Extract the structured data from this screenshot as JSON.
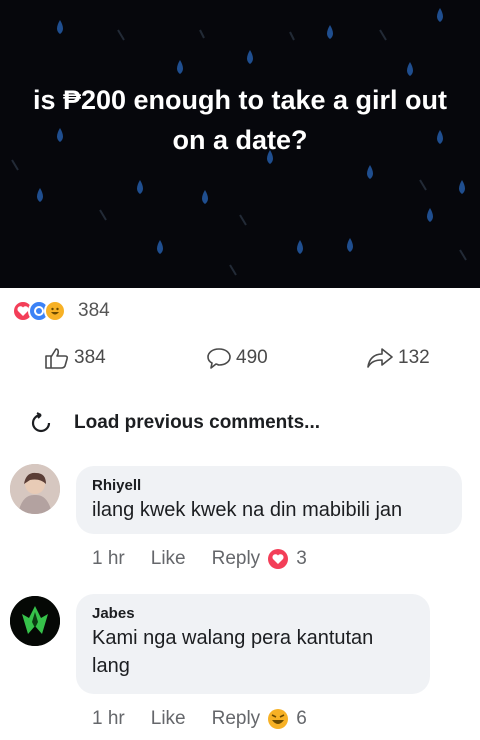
{
  "post": {
    "title": "is ₱200 enough to take a girl out on a date?"
  },
  "reactions": {
    "icons": [
      "love-reaction-icon",
      "care-reaction-icon",
      "haha-reaction-icon"
    ],
    "count": "384"
  },
  "actions": {
    "like_count": "384",
    "comment_count": "490",
    "share_count": "132"
  },
  "load_previous": "Load previous comments...",
  "comments": [
    {
      "author": "Rhiyell",
      "text": "ilang kwek kwek na din mabibili jan",
      "time": "1 hr",
      "like": "Like",
      "reply": "Reply",
      "reaction_icon": "love-reaction-icon",
      "reaction_count": "3"
    },
    {
      "author": "Jabes",
      "text": "Kami nga walang pera kantutan lang",
      "time": "1 hr",
      "like": "Like",
      "reply": "Reply",
      "reaction_icon": "haha-reaction-icon",
      "reaction_count": "6"
    }
  ],
  "colors": {
    "post_background": "#06070c",
    "rain_drops": "#1f4e8f",
    "love": "#f33e58",
    "haha": "#f7b125",
    "bubble": "#f0f2f5",
    "meta_text": "#65676b"
  }
}
